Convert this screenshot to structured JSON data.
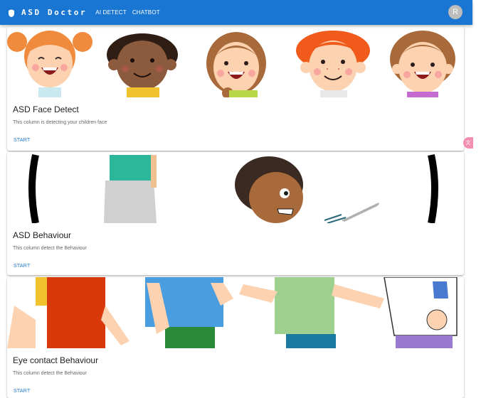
{
  "appbar": {
    "brand": "ASD Doctor",
    "nav": [
      "AI DETECT",
      "CHATBOT"
    ],
    "avatar_initial": "R",
    "color": "#1976d2"
  },
  "cards": [
    {
      "title": "ASD Face Detect",
      "description": "This column is detecting your children face",
      "action": "START"
    },
    {
      "title": "ASD Behaviour",
      "description": "This column detect the Behaviour",
      "action": "START"
    },
    {
      "title": "Eye contact Behaviour",
      "description": "This column detect the Behaviour",
      "action": "START"
    }
  ],
  "side_widget": {
    "icon": "translate-icon",
    "label": "文"
  }
}
